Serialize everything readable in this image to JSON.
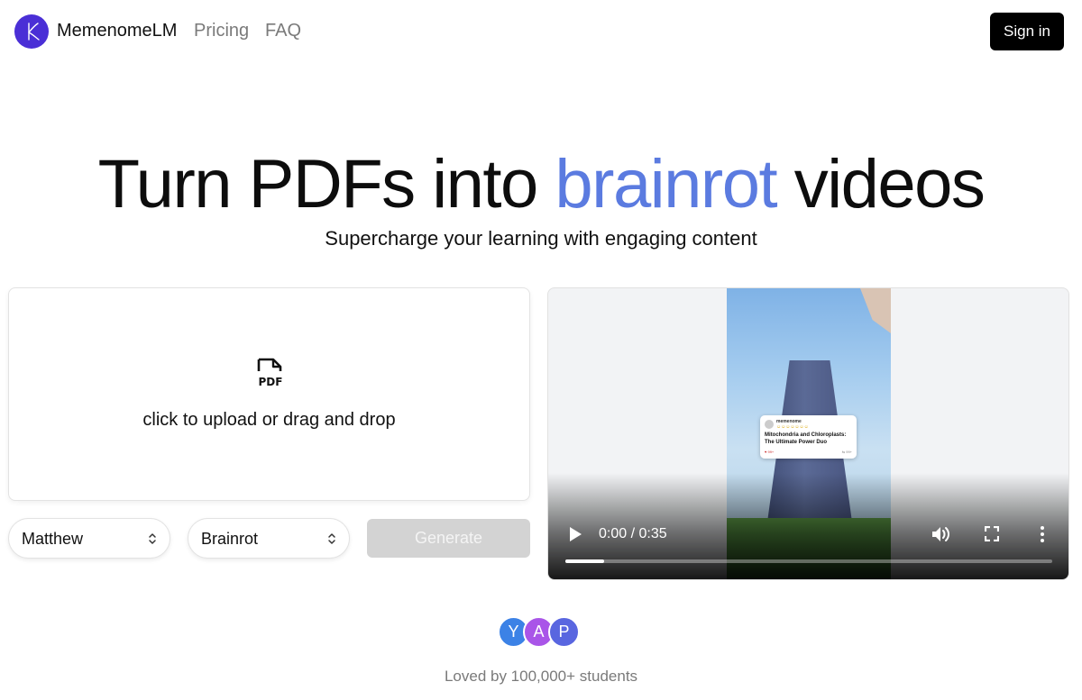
{
  "nav": {
    "brand": "MemenomeLM",
    "links": [
      "Pricing",
      "FAQ"
    ],
    "signin_label": "Sign in"
  },
  "hero": {
    "title_part1": "Turn PDFs into ",
    "title_accent": "brainrot",
    "title_part2": " videos",
    "subtitle": "Supercharge your learning with engaging content",
    "accent_color": "#5b7be0"
  },
  "upload": {
    "icon": "pdf-file-icon",
    "icon_label": "PDF",
    "text": "click to upload or drag and drop"
  },
  "controls": {
    "voice_value": "Matthew",
    "style_value": "Brainrot",
    "generate_label": "Generate"
  },
  "video": {
    "time_display": "0:00 / 0:35",
    "progress_fraction": 0.08,
    "card": {
      "username": "memenome",
      "emoji_row": "☺☺☺☺☺☺☺",
      "title": "Mitochondria and Chloroplasts: The Ultimate Power Duo",
      "likes": "♥ 99+",
      "shares": "⇆ 99+"
    }
  },
  "social": {
    "avatars": [
      "Y",
      "A",
      "P"
    ],
    "text": "Loved by 100,000+ students"
  }
}
